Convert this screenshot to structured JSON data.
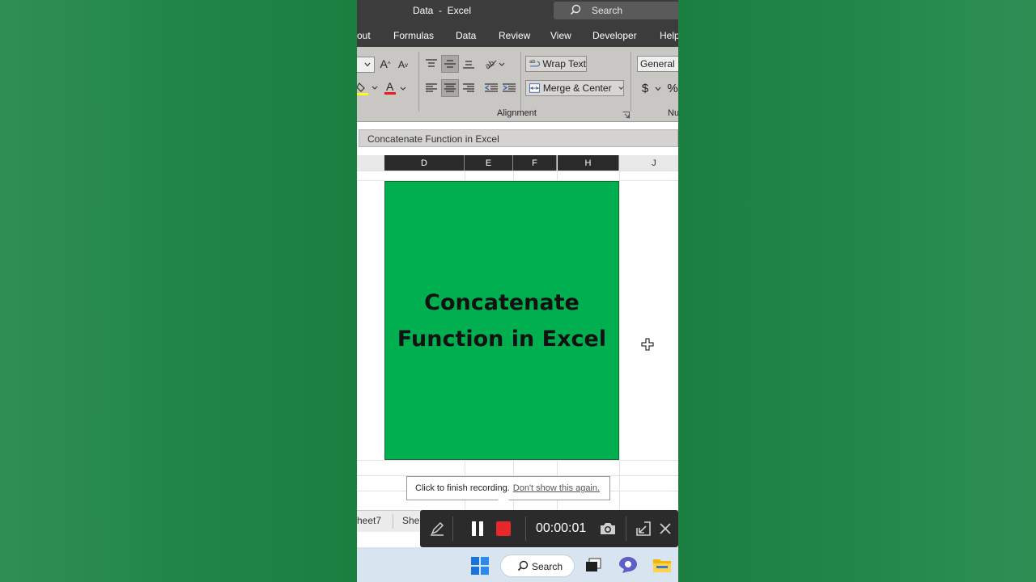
{
  "window": {
    "title": "Data  -  Excel",
    "search_label": "Search"
  },
  "ribbon_tabs": [
    "out",
    "Formulas",
    "Data",
    "Review",
    "View",
    "Developer",
    "Help"
  ],
  "ribbon": {
    "font_grow": "A",
    "font_shrink": "A",
    "wrap_text": "Wrap Text",
    "merge_center": "Merge & Center",
    "number_format": "General",
    "currency_symbol": "$",
    "percent_symbol": "%",
    "alignment_group": "Alignment",
    "number_group_partial": "Nu"
  },
  "formula_bar": {
    "text": "Concatenate Function in Excel"
  },
  "columns": [
    "D",
    "E",
    "F",
    "H",
    "J"
  ],
  "merged_cell": {
    "line1": "Concatenate",
    "line2": "Function in Excel",
    "fill": "#00b050"
  },
  "tooltip": {
    "text": "Click to finish recording.",
    "link": "Don't show this again."
  },
  "sheet_tabs": [
    "heet7",
    "She"
  ],
  "recorder": {
    "timer": "00:00:01",
    "stop_color": "#e8262b"
  },
  "taskbar": {
    "search_label": "Search"
  }
}
